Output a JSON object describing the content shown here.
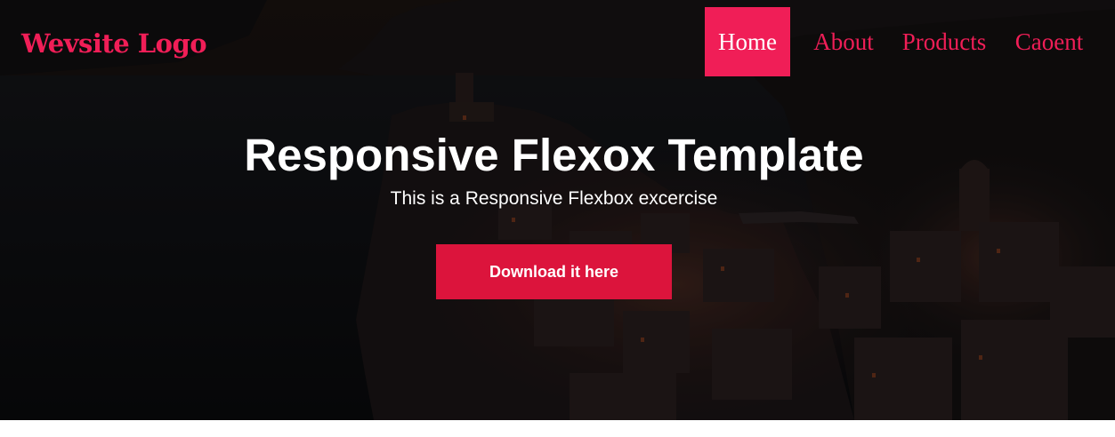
{
  "header": {
    "logo_text": "Wevsite Logo",
    "nav": [
      {
        "label": "Home",
        "active": true
      },
      {
        "label": "About",
        "active": false
      },
      {
        "label": "Products",
        "active": false
      },
      {
        "label": "Caoent",
        "active": false
      }
    ]
  },
  "hero": {
    "title": "Responsive Flexox Template",
    "subtitle": "This is a Responsive Flexbox excercise",
    "cta_label": "Download it here",
    "background_icon": "coastal-village-night-photo"
  },
  "colors": {
    "accent": "#f01e57",
    "cta": "#dc143c",
    "text": "#ffffff",
    "overlay": "#0b0a0c",
    "page": "#ffffff"
  }
}
